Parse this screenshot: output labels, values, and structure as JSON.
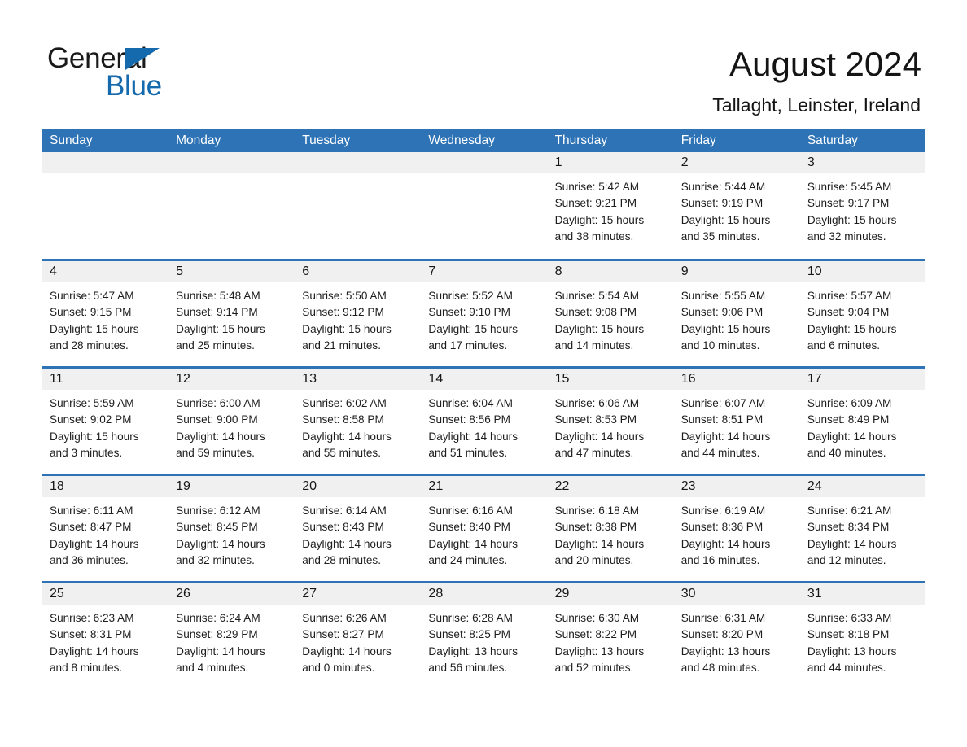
{
  "logo": {
    "word_one": "General",
    "word_two": "Blue",
    "triangle_color": "#1569ad",
    "icon": "triangle-logo-mark"
  },
  "header": {
    "title": "August 2024",
    "subtitle": "Tallaght, Leinster, Ireland"
  },
  "theme": {
    "header_blue": "#2e73b5",
    "row_divider_blue": "#2e73b5",
    "date_strip_gray": "#f0f0f0",
    "text_color": "#1a1a1a"
  },
  "calendar": {
    "weekdays": [
      "Sunday",
      "Monday",
      "Tuesday",
      "Wednesday",
      "Thursday",
      "Friday",
      "Saturday"
    ],
    "weeks": [
      [
        {
          "day": "",
          "lines": []
        },
        {
          "day": "",
          "lines": []
        },
        {
          "day": "",
          "lines": []
        },
        {
          "day": "",
          "lines": []
        },
        {
          "day": "1",
          "lines": [
            "Sunrise: 5:42 AM",
            "Sunset: 9:21 PM",
            "Daylight: 15 hours",
            "and 38 minutes."
          ]
        },
        {
          "day": "2",
          "lines": [
            "Sunrise: 5:44 AM",
            "Sunset: 9:19 PM",
            "Daylight: 15 hours",
            "and 35 minutes."
          ]
        },
        {
          "day": "3",
          "lines": [
            "Sunrise: 5:45 AM",
            "Sunset: 9:17 PM",
            "Daylight: 15 hours",
            "and 32 minutes."
          ]
        }
      ],
      [
        {
          "day": "4",
          "lines": [
            "Sunrise: 5:47 AM",
            "Sunset: 9:15 PM",
            "Daylight: 15 hours",
            "and 28 minutes."
          ]
        },
        {
          "day": "5",
          "lines": [
            "Sunrise: 5:48 AM",
            "Sunset: 9:14 PM",
            "Daylight: 15 hours",
            "and 25 minutes."
          ]
        },
        {
          "day": "6",
          "lines": [
            "Sunrise: 5:50 AM",
            "Sunset: 9:12 PM",
            "Daylight: 15 hours",
            "and 21 minutes."
          ]
        },
        {
          "day": "7",
          "lines": [
            "Sunrise: 5:52 AM",
            "Sunset: 9:10 PM",
            "Daylight: 15 hours",
            "and 17 minutes."
          ]
        },
        {
          "day": "8",
          "lines": [
            "Sunrise: 5:54 AM",
            "Sunset: 9:08 PM",
            "Daylight: 15 hours",
            "and 14 minutes."
          ]
        },
        {
          "day": "9",
          "lines": [
            "Sunrise: 5:55 AM",
            "Sunset: 9:06 PM",
            "Daylight: 15 hours",
            "and 10 minutes."
          ]
        },
        {
          "day": "10",
          "lines": [
            "Sunrise: 5:57 AM",
            "Sunset: 9:04 PM",
            "Daylight: 15 hours",
            "and 6 minutes."
          ]
        }
      ],
      [
        {
          "day": "11",
          "lines": [
            "Sunrise: 5:59 AM",
            "Sunset: 9:02 PM",
            "Daylight: 15 hours",
            "and 3 minutes."
          ]
        },
        {
          "day": "12",
          "lines": [
            "Sunrise: 6:00 AM",
            "Sunset: 9:00 PM",
            "Daylight: 14 hours",
            "and 59 minutes."
          ]
        },
        {
          "day": "13",
          "lines": [
            "Sunrise: 6:02 AM",
            "Sunset: 8:58 PM",
            "Daylight: 14 hours",
            "and 55 minutes."
          ]
        },
        {
          "day": "14",
          "lines": [
            "Sunrise: 6:04 AM",
            "Sunset: 8:56 PM",
            "Daylight: 14 hours",
            "and 51 minutes."
          ]
        },
        {
          "day": "15",
          "lines": [
            "Sunrise: 6:06 AM",
            "Sunset: 8:53 PM",
            "Daylight: 14 hours",
            "and 47 minutes."
          ]
        },
        {
          "day": "16",
          "lines": [
            "Sunrise: 6:07 AM",
            "Sunset: 8:51 PM",
            "Daylight: 14 hours",
            "and 44 minutes."
          ]
        },
        {
          "day": "17",
          "lines": [
            "Sunrise: 6:09 AM",
            "Sunset: 8:49 PM",
            "Daylight: 14 hours",
            "and 40 minutes."
          ]
        }
      ],
      [
        {
          "day": "18",
          "lines": [
            "Sunrise: 6:11 AM",
            "Sunset: 8:47 PM",
            "Daylight: 14 hours",
            "and 36 minutes."
          ]
        },
        {
          "day": "19",
          "lines": [
            "Sunrise: 6:12 AM",
            "Sunset: 8:45 PM",
            "Daylight: 14 hours",
            "and 32 minutes."
          ]
        },
        {
          "day": "20",
          "lines": [
            "Sunrise: 6:14 AM",
            "Sunset: 8:43 PM",
            "Daylight: 14 hours",
            "and 28 minutes."
          ]
        },
        {
          "day": "21",
          "lines": [
            "Sunrise: 6:16 AM",
            "Sunset: 8:40 PM",
            "Daylight: 14 hours",
            "and 24 minutes."
          ]
        },
        {
          "day": "22",
          "lines": [
            "Sunrise: 6:18 AM",
            "Sunset: 8:38 PM",
            "Daylight: 14 hours",
            "and 20 minutes."
          ]
        },
        {
          "day": "23",
          "lines": [
            "Sunrise: 6:19 AM",
            "Sunset: 8:36 PM",
            "Daylight: 14 hours",
            "and 16 minutes."
          ]
        },
        {
          "day": "24",
          "lines": [
            "Sunrise: 6:21 AM",
            "Sunset: 8:34 PM",
            "Daylight: 14 hours",
            "and 12 minutes."
          ]
        }
      ],
      [
        {
          "day": "25",
          "lines": [
            "Sunrise: 6:23 AM",
            "Sunset: 8:31 PM",
            "Daylight: 14 hours",
            "and 8 minutes."
          ]
        },
        {
          "day": "26",
          "lines": [
            "Sunrise: 6:24 AM",
            "Sunset: 8:29 PM",
            "Daylight: 14 hours",
            "and 4 minutes."
          ]
        },
        {
          "day": "27",
          "lines": [
            "Sunrise: 6:26 AM",
            "Sunset: 8:27 PM",
            "Daylight: 14 hours",
            "and 0 minutes."
          ]
        },
        {
          "day": "28",
          "lines": [
            "Sunrise: 6:28 AM",
            "Sunset: 8:25 PM",
            "Daylight: 13 hours",
            "and 56 minutes."
          ]
        },
        {
          "day": "29",
          "lines": [
            "Sunrise: 6:30 AM",
            "Sunset: 8:22 PM",
            "Daylight: 13 hours",
            "and 52 minutes."
          ]
        },
        {
          "day": "30",
          "lines": [
            "Sunrise: 6:31 AM",
            "Sunset: 8:20 PM",
            "Daylight: 13 hours",
            "and 48 minutes."
          ]
        },
        {
          "day": "31",
          "lines": [
            "Sunrise: 6:33 AM",
            "Sunset: 8:18 PM",
            "Daylight: 13 hours",
            "and 44 minutes."
          ]
        }
      ]
    ]
  }
}
